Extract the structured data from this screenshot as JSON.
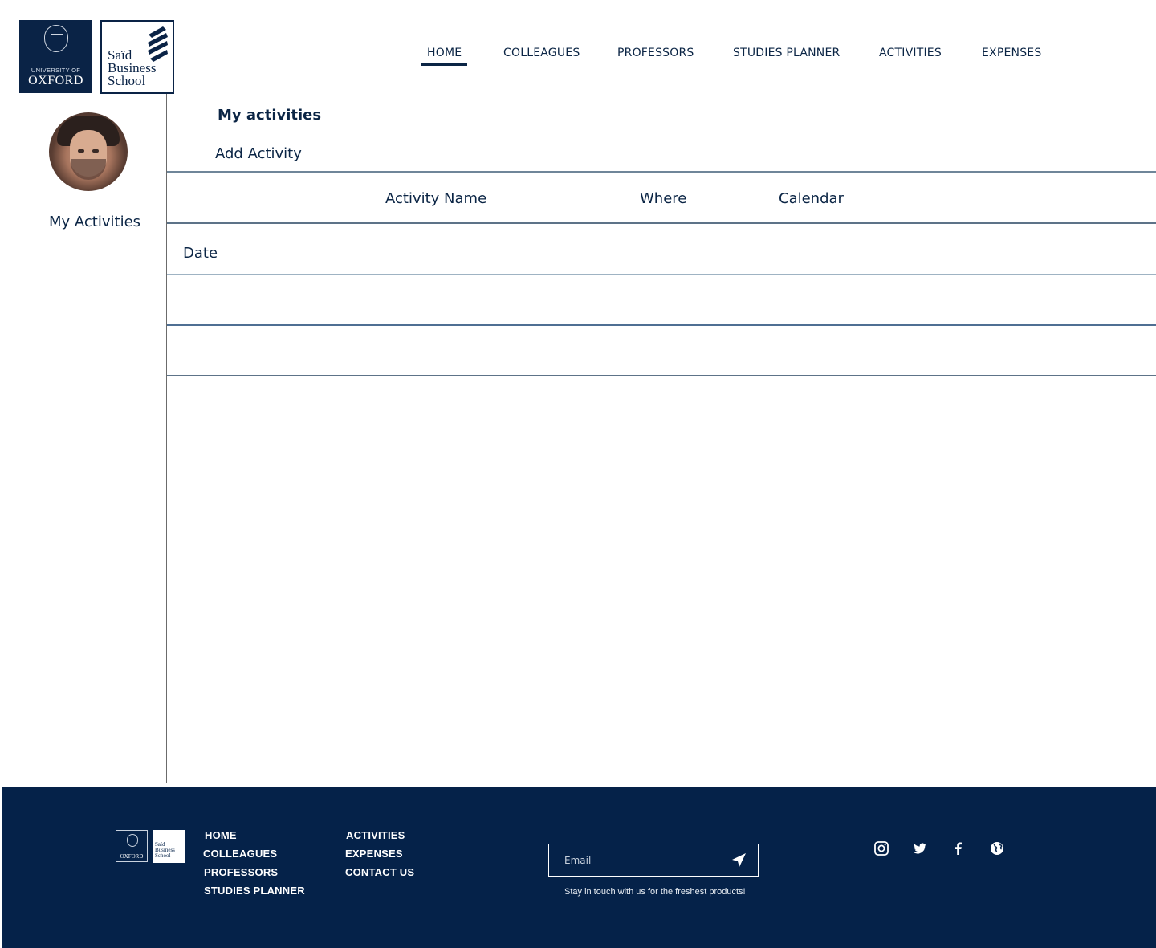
{
  "brand": {
    "oxford_small": "UNIVERSITY OF",
    "oxford_big": "OXFORD",
    "said_text": [
      "Saïd",
      "Business",
      "School"
    ]
  },
  "nav": {
    "items": [
      {
        "label": "HOME",
        "active": true
      },
      {
        "label": "COLLEAGUES",
        "active": false
      },
      {
        "label": "PROFESSORS",
        "active": false
      },
      {
        "label": "STUDIES PLANNER",
        "active": false
      },
      {
        "label": "ACTIVITIES",
        "active": false
      },
      {
        "label": "EXPENSES",
        "active": false
      }
    ]
  },
  "sidebar": {
    "avatar_icon": "user-avatar",
    "link_label": "My Activities"
  },
  "main": {
    "title": "My activities",
    "add_activity_label": "Add Activity",
    "table": {
      "headers": [
        "Activity Name",
        "Where",
        "Calendar"
      ],
      "rows": [
        {
          "label": "Date"
        },
        {
          "label": ""
        },
        {
          "label": ""
        }
      ]
    }
  },
  "footer": {
    "links_col1": [
      "HOME",
      "COLLEAGUES",
      "PROFESSORS",
      "STUDIES PLANNER"
    ],
    "links_col2": [
      "ACTIVITIES",
      "EXPENSES",
      "CONTACT US"
    ],
    "email_placeholder": "Email",
    "newsletter_text": "Stay in touch with us for the freshest products!",
    "social_icons": [
      "instagram-icon",
      "twitter-icon",
      "facebook-icon",
      "globe-icon"
    ]
  },
  "colors": {
    "primary": "#0b2545",
    "footer_bg": "#052249",
    "line_dark": "#5d7388",
    "line_light": "#9fb3c3",
    "line_blue": "#4f6f93"
  }
}
